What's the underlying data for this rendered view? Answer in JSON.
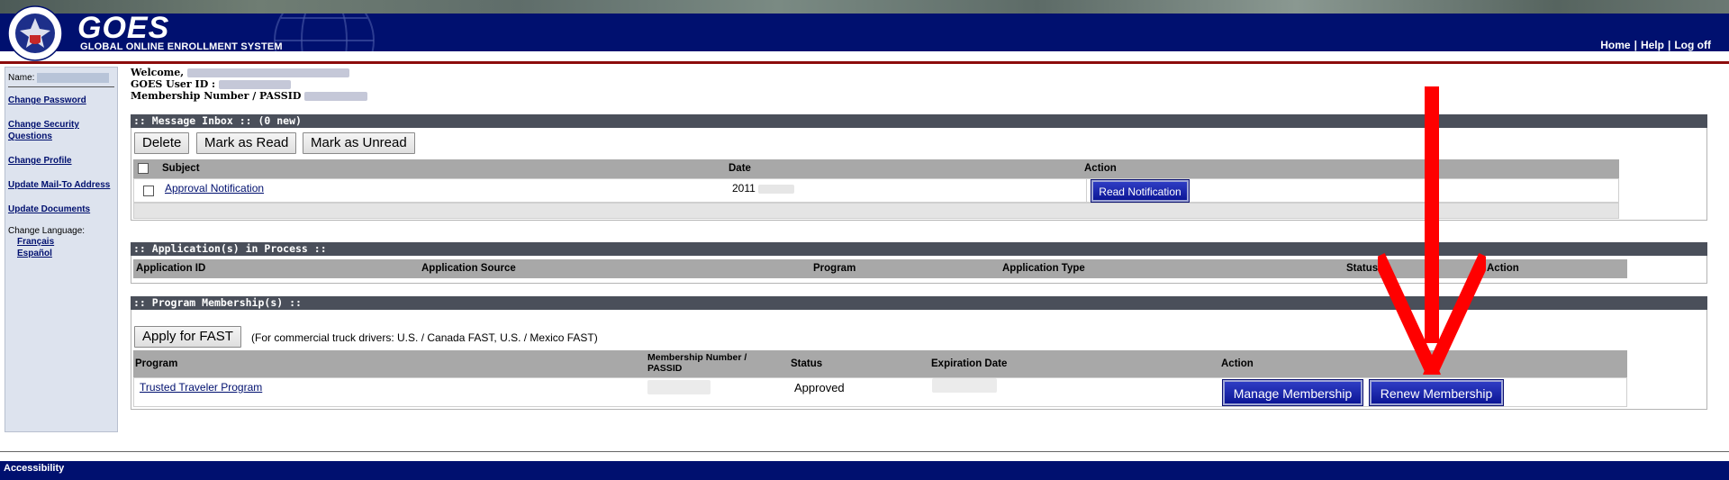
{
  "app": {
    "logo_title": "GOES",
    "logo_subtitle": "GLOBAL ONLINE ENROLLMENT SYSTEM",
    "brand_color": "#00106f"
  },
  "top_nav": {
    "home": "Home",
    "help": "Help",
    "logout": "Log off",
    "separator": "|"
  },
  "sidebar": {
    "name_label": "Name:",
    "items": [
      {
        "label": "Change Password"
      },
      {
        "label": "Change Security Questions"
      },
      {
        "label": "Change Profile"
      },
      {
        "label": "Update Mail-To Address"
      },
      {
        "label": "Update Documents"
      }
    ],
    "language_label": "Change Language:",
    "languages": [
      "Français",
      "Español"
    ]
  },
  "welcome": {
    "welcome_label": "Welcome,",
    "user_id_label": "GOES User ID :",
    "membership_label": "Membership Number / PASSID"
  },
  "inbox": {
    "title": ":: Message Inbox :: (0 new)",
    "buttons": {
      "delete": "Delete",
      "mark_read": "Mark as Read",
      "mark_unread": "Mark as Unread"
    },
    "columns": [
      "Subject",
      "Date",
      "Action"
    ],
    "rows": [
      {
        "subject": "Approval Notification",
        "date": "2011",
        "action": "Read Notification"
      }
    ]
  },
  "applications": {
    "title": ":: Application(s) in Process ::",
    "columns": [
      "Application ID",
      "Application Source",
      "Program",
      "Application Type",
      "Status",
      "Action"
    ]
  },
  "memberships": {
    "title": ":: Program Membership(s) ::",
    "apply_button": "Apply for FAST",
    "apply_note": "(For commercial truck drivers: U.S. / Canada FAST, U.S. / Mexico FAST)",
    "columns": [
      "Program",
      "Membership Number / PASSID",
      "Status",
      "Expiration Date",
      "Action"
    ],
    "rows": [
      {
        "program": "Trusted Traveler Program",
        "status": "Approved",
        "manage": "Manage Membership",
        "renew": "Renew Membership"
      }
    ]
  },
  "footer": {
    "accessibility": "Accessibility"
  },
  "annotation": {
    "arrow_color": "#ff0000"
  }
}
